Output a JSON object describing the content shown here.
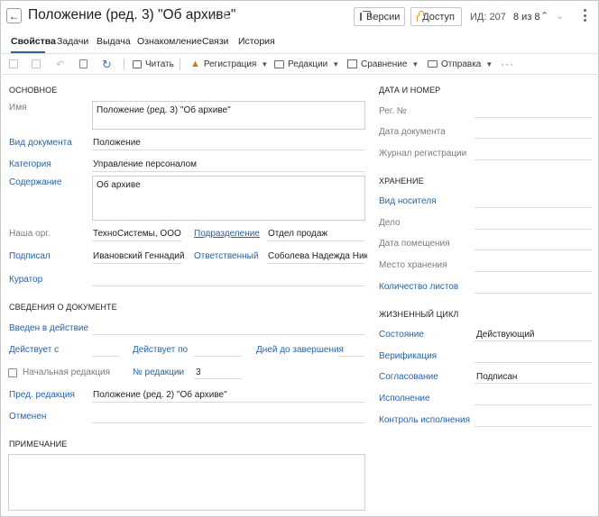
{
  "header": {
    "title": "Положение (ред. 3) \"Об архиве\"",
    "versions_label": "Версии",
    "access_label": "Доступ",
    "id_text": "ИД: 207",
    "pager_text": "8 из 8"
  },
  "tabs": [
    {
      "label": "Свойства"
    },
    {
      "label": "Задачи"
    },
    {
      "label": "Выдача"
    },
    {
      "label": "Ознакомление"
    },
    {
      "label": "Связи"
    },
    {
      "label": "История"
    }
  ],
  "toolbar": {
    "print": "Читать",
    "registration": "Регистрация",
    "redactions": "Редакции",
    "comparison": "Сравнение",
    "sending": "Отправка"
  },
  "main": {
    "section": "ОСНОВНОЕ",
    "name_label": "Имя",
    "name_value": "Положение (ред. 3) \"Об архиве\"",
    "doctype_label": "Вид документа",
    "doctype_value": "Положение",
    "category_label": "Категория",
    "category_value": "Управление персоналом",
    "content_label": "Содержание",
    "content_value": "Об архиве",
    "org_label": "Наша орг.",
    "org_value": "ТехноСистемы, ООО",
    "dept_label": "Подразделение",
    "dept_value": "Отдел продаж",
    "signed_label": "Подписал",
    "signed_value": "Ивановский Геннадий",
    "responsible_label": "Ответственный",
    "responsible_value": "Соболева Надежда Нико...",
    "curator_label": "Куратор"
  },
  "details": {
    "section": "СВЕДЕНИЯ О ДОКУМЕНТЕ",
    "effective_label": "Введен в действие",
    "valid_from_label": "Действует с",
    "valid_to_label": "Действует по",
    "days_left_label": "Дней до завершения",
    "initial_label": "Начальная редакция",
    "redaction_no_label": "№ редакции",
    "redaction_no_value": "3",
    "prev_label": "Пред. редакция",
    "prev_value": "Положение (ред. 2) \"Об архиве\"",
    "canceled_label": "Отменен"
  },
  "note": {
    "section": "ПРИМЕЧАНИЕ"
  },
  "regdate": {
    "section": "ДАТА И НОМЕР",
    "reg_no_label": "Рег. №",
    "doc_date_label": "Дата документа",
    "journal_label": "Журнал регистрации"
  },
  "storage": {
    "section": "ХРАНЕНИЕ",
    "media_label": "Вид носителя",
    "case_label": "Дело",
    "placed_label": "Дата помещения",
    "place_label": "Место хранения",
    "sheets_label": "Количество листов"
  },
  "lifecycle": {
    "section": "ЖИЗНЕННЫЙ ЦИКЛ",
    "state_label": "Состояние",
    "state_value": "Действующий",
    "verify_label": "Верификация",
    "approval_label": "Согласование",
    "approval_value": "Подписан",
    "execution_label": "Исполнение",
    "exec_control_label": "Контроль исполнения"
  },
  "colors": {
    "link": "#2563a6",
    "tab_accent": "#2a62a8",
    "lock": "#d89a2a"
  }
}
